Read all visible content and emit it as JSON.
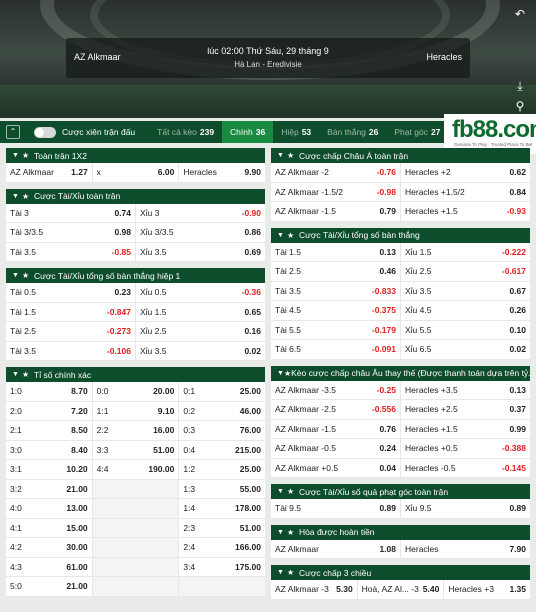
{
  "header": {
    "home": "AZ Alkmaar",
    "away": "Heracles",
    "time": "lúc 02:00 Thứ Sáu, 29 tháng 9",
    "league": "Hà Lan - Eredivisie",
    "icons": [
      "back-icon",
      "download-icon",
      "pin-icon"
    ]
  },
  "tabbar": {
    "toggle_label": "Cược xiên trận đấu",
    "tabs": [
      {
        "label": "Tất cả kèo",
        "count": "239"
      },
      {
        "label": "Chính",
        "count": "36"
      },
      {
        "label": "Hiệp",
        "count": "53"
      },
      {
        "label": "Bàn thắng",
        "count": "26"
      },
      {
        "label": "Phạt góc",
        "count": "27"
      }
    ]
  },
  "logo": {
    "text": "fb88.com",
    "tag": "Genuine To Play · Trusted Place To Bet"
  },
  "left": [
    {
      "title": "Toàn trận 1X2",
      "rows": [
        [
          [
            "AZ Alkmaar",
            "1.27"
          ],
          [
            "x",
            "6.00"
          ],
          [
            "Heracles",
            "9.90"
          ]
        ]
      ]
    },
    {
      "title": "Cược Tài/Xỉu toàn trận",
      "rows": [
        [
          [
            "Tài 3",
            "0.74"
          ],
          [
            "Xỉu 3",
            "-0.90"
          ]
        ],
        [
          [
            "Tài 3/3.5",
            "0.98"
          ],
          [
            "Xỉu 3/3.5",
            "0.86"
          ]
        ],
        [
          [
            "Tài 3.5",
            "-0.85"
          ],
          [
            "Xỉu 3.5",
            "0.69"
          ]
        ]
      ]
    },
    {
      "title": "Cược Tài/Xỉu tổng số bàn thắng hiệp 1",
      "rows": [
        [
          [
            "Tài 0.5",
            "0.23"
          ],
          [
            "Xỉu 0.5",
            "-0.36"
          ]
        ],
        [
          [
            "Tài 1.5",
            "-0.847"
          ],
          [
            "Xỉu 1.5",
            "0.65"
          ]
        ],
        [
          [
            "Tài 2.5",
            "-0.273"
          ],
          [
            "Xỉu 2.5",
            "0.16"
          ]
        ],
        [
          [
            "Tài 3.5",
            "-0.106"
          ],
          [
            "Xỉu 3.5",
            "0.02"
          ]
        ]
      ]
    },
    {
      "title": "Tỉ số chính xác",
      "rows": [
        [
          [
            "1:0",
            "8.70"
          ],
          [
            "0:0",
            "20.00"
          ],
          [
            "0:1",
            "25.00"
          ]
        ],
        [
          [
            "2:0",
            "7.20"
          ],
          [
            "1:1",
            "9.10"
          ],
          [
            "0:2",
            "46.00"
          ]
        ],
        [
          [
            "2:1",
            "8.50"
          ],
          [
            "2:2",
            "16.00"
          ],
          [
            "0:3",
            "76.00"
          ]
        ],
        [
          [
            "3:0",
            "8.40"
          ],
          [
            "3:3",
            "51.00"
          ],
          [
            "0:4",
            "215.00"
          ]
        ],
        [
          [
            "3:1",
            "10.20"
          ],
          [
            "4:4",
            "190.00"
          ],
          [
            "1:2",
            "25.00"
          ]
        ],
        [
          [
            "3:2",
            "21.00"
          ],
          null,
          [
            "1:3",
            "55.00"
          ]
        ],
        [
          [
            "4:0",
            "13.00"
          ],
          null,
          [
            "1:4",
            "178.00"
          ]
        ],
        [
          [
            "4:1",
            "15.00"
          ],
          null,
          [
            "2:3",
            "51.00"
          ]
        ],
        [
          [
            "4:2",
            "30.00"
          ],
          null,
          [
            "2:4",
            "166.00"
          ]
        ],
        [
          [
            "4:3",
            "61.00"
          ],
          null,
          [
            "3:4",
            "175.00"
          ]
        ],
        [
          [
            "5:0",
            "21.00"
          ],
          null,
          null
        ]
      ]
    }
  ],
  "right": [
    {
      "title": "Cược chấp Châu Á toàn trận",
      "rows": [
        [
          [
            "AZ Alkmaar -2",
            "-0.76"
          ],
          [
            "Heracles +2",
            "0.62"
          ]
        ],
        [
          [
            "AZ Alkmaar -1.5/2",
            "-0.98"
          ],
          [
            "Heracles +1.5/2",
            "0.84"
          ]
        ],
        [
          [
            "AZ Alkmaar -1.5",
            "0.79"
          ],
          [
            "Heracles +1.5",
            "-0.93"
          ]
        ]
      ]
    },
    {
      "title": "Cược Tài/Xỉu tổng số bàn thắng",
      "rows": [
        [
          [
            "Tài 1.5",
            "0.13"
          ],
          [
            "Xỉu 1.5",
            "-0.222"
          ]
        ],
        [
          [
            "Tài 2.5",
            "0.46"
          ],
          [
            "Xỉu 2.5",
            "-0.617"
          ]
        ],
        [
          [
            "Tài 3.5",
            "-0.833"
          ],
          [
            "Xỉu 3.5",
            "0.67"
          ]
        ],
        [
          [
            "Tài 4.5",
            "-0.375"
          ],
          [
            "Xỉu 4.5",
            "0.26"
          ]
        ],
        [
          [
            "Tài 5.5",
            "-0.179"
          ],
          [
            "Xỉu 5.5",
            "0.10"
          ]
        ],
        [
          [
            "Tài 6.5",
            "-0.091"
          ],
          [
            "Xỉu 6.5",
            "0.02"
          ]
        ]
      ]
    },
    {
      "title": "Kèo cược chấp châu Âu thay thế (Được thanh toán dựa trên tỷ...",
      "rows": [
        [
          [
            "AZ Alkmaar -3.5",
            "-0.25"
          ],
          [
            "Heracles +3.5",
            "0.13"
          ]
        ],
        [
          [
            "AZ Alkmaar -2.5",
            "-0.556"
          ],
          [
            "Heracles +2.5",
            "0.37"
          ]
        ],
        [
          [
            "AZ Alkmaar -1.5",
            "0.76"
          ],
          [
            "Heracles +1.5",
            "0.99"
          ]
        ],
        [
          [
            "AZ Alkmaar -0.5",
            "0.24"
          ],
          [
            "Heracles +0.5",
            "-0.388"
          ]
        ],
        [
          [
            "AZ Alkmaar +0.5",
            "0.04"
          ],
          [
            "Heracles -0.5",
            "-0.145"
          ]
        ]
      ]
    },
    {
      "title": "Cược Tài/Xỉu số quả phạt góc toàn trận",
      "rows": [
        [
          [
            "Tài 9.5",
            "0.89"
          ],
          [
            "Xỉu 9.5",
            "0.89"
          ]
        ]
      ]
    },
    {
      "title": "Hòa được hoàn tiền",
      "rows": [
        [
          [
            "AZ Alkmaar",
            "1.08"
          ],
          [
            "Heracles",
            "7.90"
          ]
        ]
      ]
    },
    {
      "title": "Cược chấp 3 chiều",
      "rows": [
        [
          [
            "AZ Alkmaar -3",
            "5.30"
          ],
          [
            "Hoà, AZ Al... -3",
            "5.40"
          ],
          [
            "Heracles +3",
            "1.35"
          ]
        ]
      ]
    }
  ]
}
